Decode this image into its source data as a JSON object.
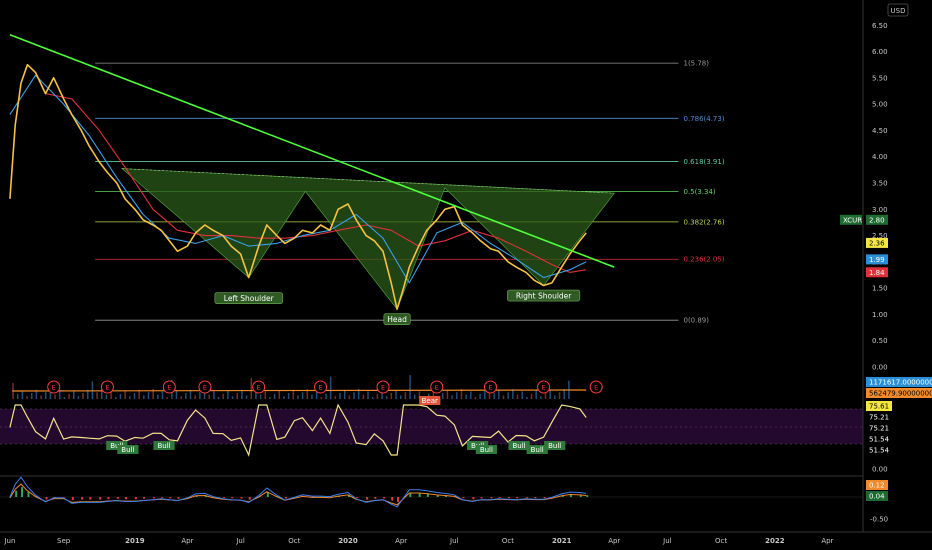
{
  "colors": {
    "background": "#000000",
    "trendline": "#4cff3a",
    "price": "#f5c242",
    "ema_red": "#e0303a",
    "ema_blue": "#3aa0e8",
    "pattern_fill": "#2b5a1a",
    "rsi_line": "#f5e38a",
    "rsi_band": "#2a0a36",
    "macd_blue": "#3b7ef0",
    "macd_orange": "#f08a2a",
    "earnings": "#ff3b3b"
  },
  "chart_data": [
    {
      "type": "line",
      "title": "",
      "symbol": "XCUR",
      "currency": "USD",
      "x_ticks": [
        "Jun",
        "Sep",
        "2019",
        "Apr",
        "Jul",
        "Oct",
        "2020",
        "Apr",
        "Jul",
        "Oct",
        "2021",
        "Apr",
        "Jul",
        "Oct",
        "2022",
        "Apr"
      ],
      "y_ticks": [
        "6.50",
        "6.00",
        "5.50",
        "5.00",
        "4.50",
        "4.00",
        "3.50",
        "3.00",
        "2.50",
        "2.00",
        "1.50",
        "1.00",
        "0.50",
        "0.00"
      ],
      "ylim": [
        0,
        6.6
      ],
      "xlim": [
        "2018-05-15",
        "2022-06-01"
      ],
      "series": [
        {
          "kind": "price",
          "x": [
            "2018-06-01",
            "2018-06-10",
            "2018-06-20",
            "2018-07-01",
            "2018-07-15",
            "2018-08-01",
            "2018-08-15",
            "2018-09-01",
            "2018-09-15",
            "2018-10-01",
            "2018-10-15",
            "2018-11-01",
            "2018-11-15",
            "2018-12-01",
            "2018-12-15",
            "2019-01-01",
            "2019-01-15",
            "2019-02-01",
            "2019-02-15",
            "2019-03-01",
            "2019-03-15",
            "2019-04-01",
            "2019-04-15",
            "2019-05-01",
            "2019-05-15",
            "2019-06-01",
            "2019-06-15",
            "2019-07-01",
            "2019-07-15",
            "2019-08-01",
            "2019-08-15",
            "2019-09-01",
            "2019-09-15",
            "2019-10-01",
            "2019-10-15",
            "2019-11-01",
            "2019-11-15",
            "2019-12-01",
            "2019-12-15",
            "2020-01-01",
            "2020-01-15",
            "2020-02-01",
            "2020-02-15",
            "2020-03-01",
            "2020-03-15",
            "2020-03-25",
            "2020-04-05",
            "2020-04-15",
            "2020-05-01",
            "2020-05-15",
            "2020-06-01",
            "2020-06-15",
            "2020-07-01",
            "2020-07-15",
            "2020-08-01",
            "2020-08-15",
            "2020-09-01",
            "2020-09-15",
            "2020-10-01",
            "2020-10-15",
            "2020-11-01",
            "2020-11-15",
            "2020-12-01",
            "2020-12-15",
            "2021-01-01",
            "2021-01-15",
            "2021-02-01",
            "2021-02-12"
          ],
          "y": [
            3.2,
            4.6,
            5.4,
            5.75,
            5.6,
            5.2,
            5.5,
            5.1,
            4.8,
            4.5,
            4.2,
            3.9,
            3.7,
            3.5,
            3.2,
            3.0,
            2.8,
            2.7,
            2.6,
            2.4,
            2.2,
            2.3,
            2.55,
            2.7,
            2.6,
            2.5,
            2.3,
            2.15,
            1.7,
            2.3,
            2.7,
            2.5,
            2.35,
            2.45,
            2.6,
            2.55,
            2.7,
            2.6,
            3.0,
            3.1,
            2.8,
            2.5,
            2.4,
            2.2,
            1.6,
            1.1,
            1.5,
            1.9,
            2.3,
            2.6,
            2.8,
            3.0,
            3.05,
            2.7,
            2.55,
            2.4,
            2.25,
            2.2,
            2.0,
            1.9,
            1.8,
            1.65,
            1.55,
            1.6,
            1.9,
            2.15,
            2.4,
            2.55
          ]
        },
        {
          "kind": "ema_fast",
          "x": [
            "2018-06-01",
            "2018-07-15",
            "2018-09-01",
            "2018-10-15",
            "2018-12-01",
            "2019-01-15",
            "2019-03-01",
            "2019-04-15",
            "2019-06-01",
            "2019-07-15",
            "2019-09-01",
            "2019-10-15",
            "2019-12-01",
            "2020-01-15",
            "2020-03-01",
            "2020-04-15",
            "2020-06-01",
            "2020-07-15",
            "2020-09-01",
            "2020-10-15",
            "2020-12-01",
            "2021-01-15",
            "2021-02-12"
          ],
          "y": [
            4.8,
            5.55,
            5.0,
            4.4,
            3.6,
            2.9,
            2.45,
            2.35,
            2.5,
            2.3,
            2.35,
            2.5,
            2.6,
            2.9,
            2.45,
            1.6,
            2.55,
            2.75,
            2.35,
            2.05,
            1.7,
            1.85,
            2.0
          ]
        },
        {
          "kind": "ema_slow",
          "x": [
            "2018-08-01",
            "2018-09-15",
            "2018-11-01",
            "2018-12-15",
            "2019-02-01",
            "2019-03-15",
            "2019-05-01",
            "2019-06-15",
            "2019-08-01",
            "2019-09-15",
            "2019-11-01",
            "2019-12-15",
            "2020-02-01",
            "2020-03-15",
            "2020-05-01",
            "2020-06-15",
            "2020-08-01",
            "2020-09-15",
            "2020-11-01",
            "2020-12-15",
            "2021-01-15",
            "2021-02-12"
          ],
          "y": [
            5.2,
            5.1,
            4.5,
            3.8,
            3.0,
            2.6,
            2.5,
            2.5,
            2.45,
            2.45,
            2.5,
            2.6,
            2.7,
            2.6,
            2.3,
            2.4,
            2.6,
            2.45,
            2.2,
            1.95,
            1.8,
            1.85
          ]
        }
      ],
      "trendline": {
        "x": [
          "2018-06-01",
          "2021-04-01"
        ],
        "y": [
          6.32,
          1.9
        ]
      },
      "fibonacci": [
        {
          "label": "1(5.78)",
          "level": 5.78,
          "color": "#9a9a9a"
        },
        {
          "label": "0.786(4.73)",
          "level": 4.73,
          "color": "#4f8fd6"
        },
        {
          "label": "0.618(3.91)",
          "level": 3.91,
          "color": "#5fc7a0"
        },
        {
          "label": "0.5(3.34)",
          "level": 3.34,
          "color": "#5fd45f"
        },
        {
          "label": "0.382(2.76)",
          "level": 2.76,
          "color": "#b8d84a"
        },
        {
          "label": "0.236(2.05)",
          "level": 2.05,
          "color": "#e0303a"
        },
        {
          "label": "0(0.89)",
          "level": 0.89,
          "color": "#9a9a9a"
        }
      ],
      "pattern_labels": [
        {
          "text": "Left Shoulder",
          "x": "2019-07-15",
          "y": 1.3
        },
        {
          "text": "Head",
          "x": "2020-03-25",
          "y": 0.9
        },
        {
          "text": "Right Shoulder",
          "x": "2020-12-01",
          "y": 1.35
        }
      ],
      "price_tags": [
        {
          "text": "XCUR",
          "value": 2.8,
          "bg": "#1e6b32",
          "fg": "#ffffff",
          "side": "left"
        },
        {
          "text": "2.80",
          "value": 2.8,
          "bg": "#1e6b32",
          "fg": "#ffffff",
          "side": "right"
        },
        {
          "text": "2.36",
          "value": 2.36,
          "bg": "#f5e642",
          "fg": "#000000",
          "side": "right"
        },
        {
          "text": "1.99",
          "value": 1.99,
          "bg": "#2a8fd6",
          "fg": "#ffffff",
          "side": "right"
        },
        {
          "text": "1.84",
          "value": 1.84,
          "bg": "#e0303a",
          "fg": "#ffffff",
          "side": "right"
        }
      ]
    },
    {
      "type": "bar",
      "title": "",
      "volume_tags": [
        {
          "text": "1171617.00000000",
          "bg": "#2a8fd6",
          "fg": "#ffffff"
        },
        {
          "text": "562479.90000000",
          "bg": "#f08a2a",
          "fg": "#000000"
        }
      ],
      "earnings_marker": "E",
      "earnings_dates": [
        "2018-08-15",
        "2018-11-15",
        "2019-03-01",
        "2019-05-01",
        "2019-08-01",
        "2019-11-15",
        "2020-03-01",
        "2020-06-01",
        "2020-09-01",
        "2020-12-01",
        "2021-03-01"
      ]
    },
    {
      "type": "line",
      "title": "",
      "rsi_tags": [
        {
          "text": "75.61",
          "bg": "#f5e642",
          "fg": "#000000"
        },
        {
          "text": "75.21",
          "bg": "#000000",
          "fg": "#ffffff"
        },
        {
          "text": "75.21",
          "bg": "#000000",
          "fg": "#ffffff"
        },
        {
          "text": "51.54",
          "bg": "#000000",
          "fg": "#ffffff"
        },
        {
          "text": "51.54",
          "bg": "#000000",
          "fg": "#ffffff"
        }
      ],
      "signal_labels": [
        {
          "text": "Bull",
          "x": "2018-12-01",
          "kind": "bull"
        },
        {
          "text": "Bull",
          "x": "2018-12-20",
          "kind": "bull"
        },
        {
          "text": "Bull",
          "x": "2019-02-20",
          "kind": "bull"
        },
        {
          "text": "Bear",
          "x": "2020-05-20",
          "kind": "bear"
        },
        {
          "text": "Bull",
          "x": "2020-08-10",
          "kind": "bull"
        },
        {
          "text": "Bull",
          "x": "2020-08-25",
          "kind": "bull"
        },
        {
          "text": "Bull",
          "x": "2020-10-20",
          "kind": "bull"
        },
        {
          "text": "Bull",
          "x": "2020-11-20",
          "kind": "bull"
        },
        {
          "text": "Bull",
          "x": "2020-12-20",
          "kind": "bull"
        }
      ],
      "y_ticks": [
        "0.00"
      ]
    },
    {
      "type": "line",
      "title": "",
      "macd_tags": [
        {
          "text": "0.12",
          "bg": "#f08a2a",
          "fg": "#ffffff"
        },
        {
          "text": "0.04",
          "bg": "#1e6b32",
          "fg": "#ffffff"
        }
      ],
      "y_ticks": [
        "-0.50"
      ]
    }
  ]
}
